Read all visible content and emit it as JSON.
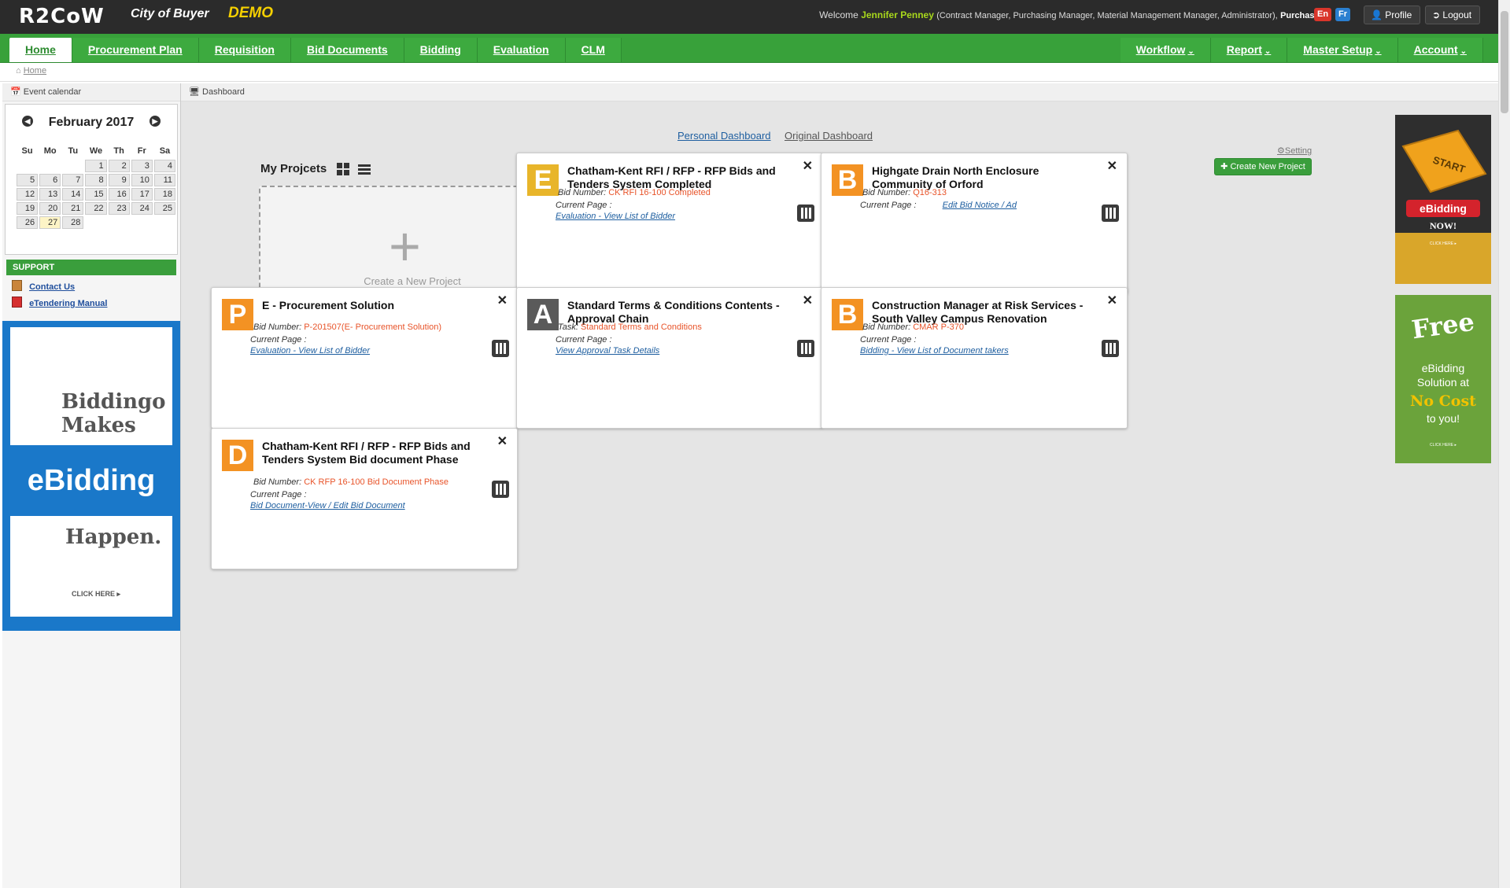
{
  "header": {
    "logo": "R2CoW",
    "org": "City of Buyer",
    "demo": "DEMO",
    "welcome_prefix": "Welcome",
    "user": "Jennifer Penney",
    "roles": "(Contract Manager, Purchasing Manager, Material Management Manager, Administrator),",
    "dept": "Purchasing",
    "lang_en": "En",
    "lang_fr": "Fr",
    "profile": "Profile",
    "logout": "Logout"
  },
  "nav": {
    "left": [
      "Home",
      "Procurement Plan",
      "Requisition",
      "Bid Documents",
      "Bidding",
      "Evaluation",
      "CLM"
    ],
    "right": [
      "Workflow",
      "Report",
      "Master Setup",
      "Account"
    ]
  },
  "breadcrumb": "Home",
  "sidebar": {
    "header": "Event calendar",
    "month": "February 2017",
    "weekdays": [
      "Su",
      "Mo",
      "Tu",
      "We",
      "Th",
      "Fr",
      "Sa"
    ],
    "weeks": [
      [
        "",
        "",
        "",
        "1",
        "2",
        "3",
        "4"
      ],
      [
        "5",
        "6",
        "7",
        "8",
        "9",
        "10",
        "11"
      ],
      [
        "12",
        "13",
        "14",
        "15",
        "16",
        "17",
        "18"
      ],
      [
        "19",
        "20",
        "21",
        "22",
        "23",
        "24",
        "25"
      ],
      [
        "26",
        "27",
        "28",
        "",
        "",
        "",
        ""
      ]
    ],
    "support_title": "SUPPORT",
    "contact": "Contact Us",
    "manual": "eTendering Manual",
    "ad": {
      "line1": "Biddingo",
      "line2": "Makes",
      "line3": "eBidding",
      "line4": "Happen.",
      "cta": "CLICK HERE ▸"
    }
  },
  "main": {
    "header": "Dashboard",
    "tab_personal": "Personal Dashboard",
    "tab_original": "Original Dashboard",
    "setting": "Setting",
    "create_btn": "Create New Project",
    "my_projects": "My Projcets",
    "new_project": "Create a New Project",
    "cards": [
      {
        "letter": "E",
        "color": "#e8b52a",
        "title": "Chatham-Kent RFI / RFP - RFP Bids and Tenders System Completed",
        "label1": "Bid Number:",
        "value1": "CK RFI 16-100 Completed",
        "label2": "Current Page :",
        "link": "Evaluation - View List of Bidder"
      },
      {
        "letter": "B",
        "color": "#f39223",
        "title": "Highgate Drain North Enclosure Community of Orford",
        "label1": "Bid Number:",
        "value1": "Q16-313",
        "label2": "Current Page :",
        "link": "Edit Bid Notice / Ad"
      },
      {
        "letter": "P",
        "color": "#f39223",
        "title": "E - Procurement Solution",
        "label1": "Bid Number:",
        "value1": "P-201507(E- Procurement Solution)",
        "label2": "Current Page :",
        "link": "Evaluation - View List of Bidder"
      },
      {
        "letter": "A",
        "color": "#5a5a5a",
        "title": "Standard Terms & Conditions Contents -Approval Chain",
        "label1": "Task:",
        "value1": "Standard Terms and Conditions",
        "label2": "Current Page :",
        "link": "View Approval Task Details"
      },
      {
        "letter": "B",
        "color": "#f39223",
        "title": "Construction Manager at Risk Services - South Valley Campus Renovation",
        "label1": "Bid Number:",
        "value1": "CMAR P-370",
        "label2": "Current Page :",
        "link": "Bidding - View List of Document takers"
      },
      {
        "letter": "D",
        "color": "#f39223",
        "title": "Chatham-Kent RFI / RFP - RFP Bids and Tenders System Bid document Phase",
        "label1": "Bid Number:",
        "value1": "CK RFP 16-100 Bid Document Phase",
        "label2": "Current Page :",
        "link": "Bid Document-View / Edit Bid Document"
      }
    ]
  },
  "ads_right": {
    "ad1": {
      "key": "START",
      "button": "eBidding",
      "now": "NOW!",
      "cta": "CLICK HERE ▸"
    },
    "ad2": {
      "free": "Free",
      "l1": "eBidding",
      "l2": "Solution at",
      "l3": "No Cost",
      "l4": "to you!",
      "cta": "CLICK HERE ▸"
    }
  }
}
